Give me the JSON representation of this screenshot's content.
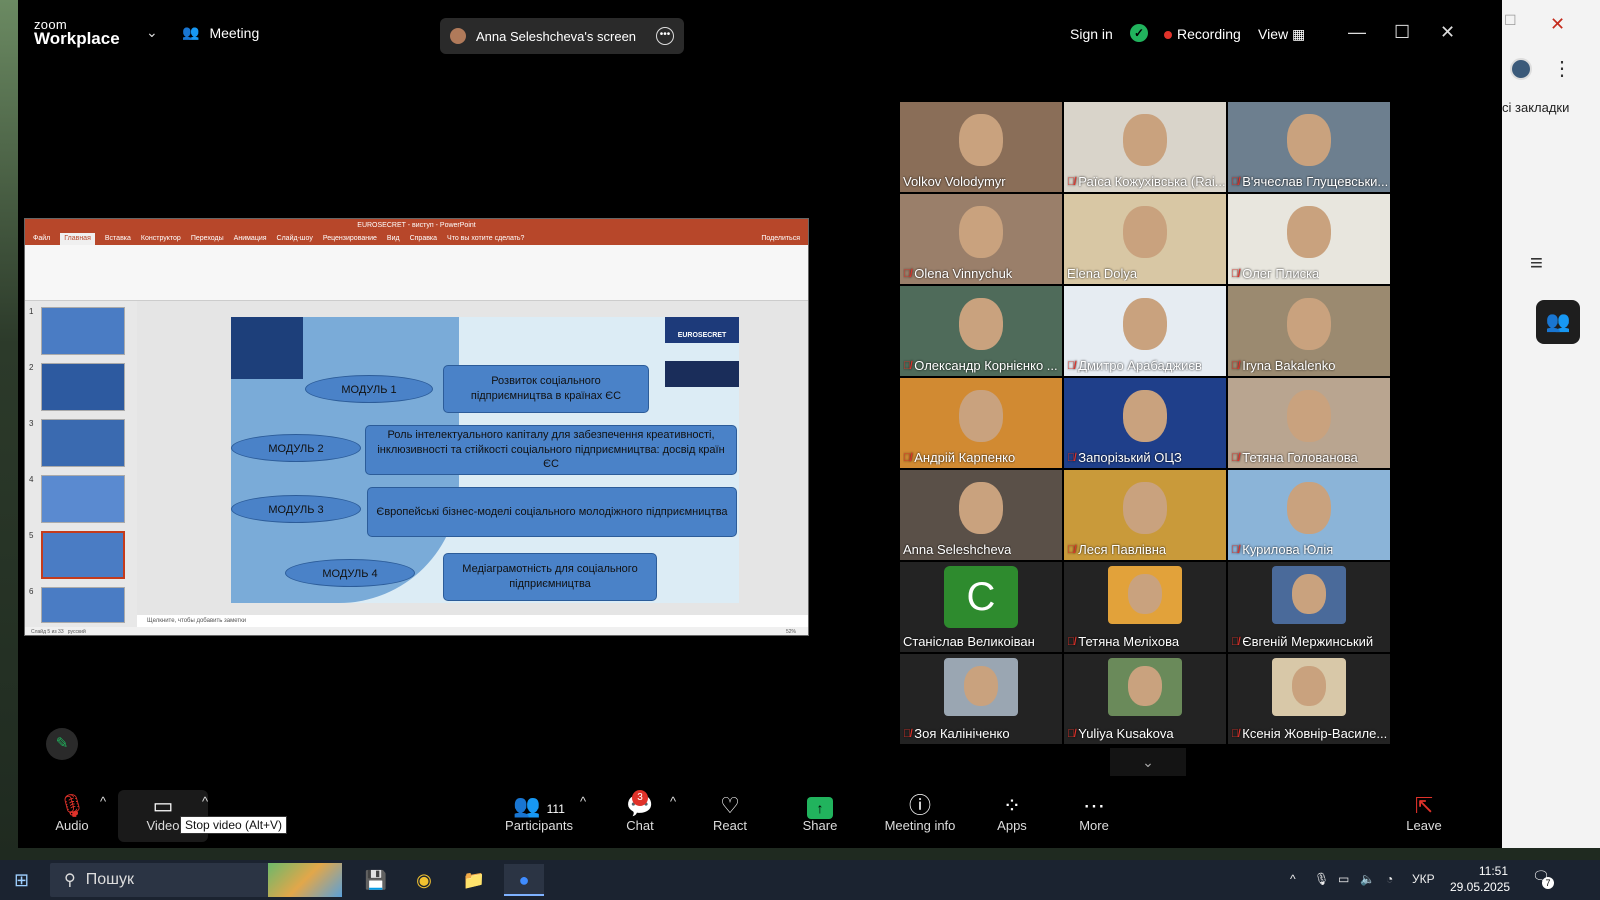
{
  "window": {
    "brand_top": "zoom",
    "brand_bottom": "Workplace",
    "meeting_label": "Meeting",
    "share_pill": "Anna Seleshcheva's screen",
    "sign_in": "Sign in",
    "recording": "Recording",
    "view": "View"
  },
  "browser_side": {
    "bookmarks_text": "сі закладки"
  },
  "slide_window": {
    "title": "EUROSECRET - виступ - PowerPoint",
    "tabs": [
      "Файл",
      "Главная",
      "Вставка",
      "Конструктор",
      "Переходы",
      "Анимация",
      "Слайд-шоу",
      "Рецензирование",
      "Вид",
      "Справка",
      "Что вы хотите сделать?"
    ],
    "share_btn": "Поделиться",
    "notes_placeholder": "Щелкните, чтобы добавить заметки",
    "status_left": "Слайд 5 из 33",
    "status_lang": "русский",
    "status_zoom": "52%",
    "thumb_numbers": [
      "1",
      "2",
      "3",
      "4",
      "5",
      "6"
    ],
    "slide": {
      "eurosecret": "EUROSECRET",
      "mod1": "МОДУЛЬ 1",
      "mod2": "МОДУЛЬ 2",
      "mod3": "МОДУЛЬ 3",
      "mod4": "МОДУЛЬ 4",
      "box1": "Розвиток соціального підприємництва в країнах ЄС",
      "box2": "Роль інтелектуального капіталу для забезпечення креативності, інклюзивності та стійкості соціального підприємництва: досвід країн ЄС",
      "box3": "Європейські бізнес-моделі соціального молодіжного підприємництва",
      "box4": "Медіаграмотність для соціального підприємництва"
    }
  },
  "gallery": [
    {
      "name": "Volkov Volodymyr",
      "muted": false,
      "active": true,
      "color": "#8a6e58"
    },
    {
      "name": "Раїса Кожухівська (Rai...",
      "muted": true,
      "color": "#d9d4ca"
    },
    {
      "name": "В'ячеслав Глущевськи...",
      "muted": true,
      "color": "#6d7f8f"
    },
    {
      "name": "Olena Vinnychuk",
      "muted": true,
      "color": "#9a7f6a"
    },
    {
      "name": "Elena Dolya",
      "muted": false,
      "color": "#d8c7a4"
    },
    {
      "name": "Олег Плиска",
      "muted": true,
      "color": "#e8e6de"
    },
    {
      "name": "Олександр Корнієнко ...",
      "muted": true,
      "color": "#4f6b5a"
    },
    {
      "name": "Дмитро Арабаджиєв",
      "muted": true,
      "color": "#e6ecf2"
    },
    {
      "name": "Iryna Bakalenko",
      "muted": true,
      "color": "#9b8a70"
    },
    {
      "name": "Андрій Карпенко",
      "muted": true,
      "color": "#d18a32"
    },
    {
      "name": "Запорізький ОЦЗ",
      "muted": true,
      "color": "#1f3f8a"
    },
    {
      "name": "Тетяна Голованова",
      "muted": true,
      "color": "#b9a590"
    },
    {
      "name": "Anna Seleshcheva",
      "muted": false,
      "color": "#5a5048"
    },
    {
      "name": "Леся Павлівна",
      "muted": true,
      "color": "#c99a3a"
    },
    {
      "name": "Курилова Юлія",
      "muted": true,
      "color": "#8bb4d8"
    },
    {
      "name": "Станіслав Великоіван",
      "muted": false,
      "letter": "C"
    },
    {
      "name": "Тетяна Меліхова",
      "muted": true,
      "color": "#e2a23a"
    },
    {
      "name": "Євгеній Мержинський",
      "muted": true,
      "color": "#4a6a9a"
    },
    {
      "name": "Зоя Калініченко",
      "muted": true,
      "color": "#9aa6b2"
    },
    {
      "name": "Yuliya Kusakova",
      "muted": true,
      "color": "#6a8a5a"
    },
    {
      "name": "Ксенія Жовнір-Василе...",
      "muted": true,
      "color": "#d8c8a8"
    }
  ],
  "toolbar": {
    "audio": "Audio",
    "video": "Video",
    "tooltip": "Stop video (Alt+V)",
    "participants": "Participants",
    "participants_count": "111",
    "chat": "Chat",
    "chat_badge": "3",
    "react": "React",
    "share": "Share",
    "meeting_info": "Meeting info",
    "apps": "Apps",
    "more": "More",
    "leave": "Leave"
  },
  "taskbar": {
    "search": "Пошук",
    "lang": "УКР",
    "time": "11:51",
    "date": "29.05.2025",
    "notifications": "7"
  }
}
